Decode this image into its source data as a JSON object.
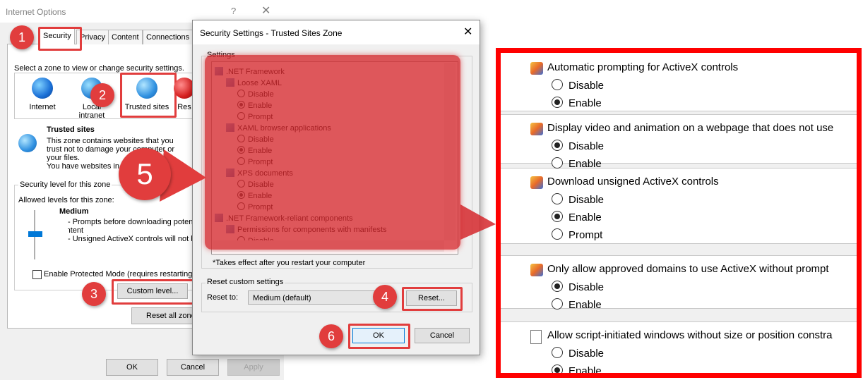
{
  "internet_options": {
    "title": "Internet Options",
    "help": "?",
    "close": "✕",
    "tabs": [
      "Security",
      "Privacy",
      "Content",
      "Connections"
    ],
    "zone_prompt": "Select a zone to view or change security settings.",
    "zones": [
      "Internet",
      "Local intranet",
      "Trusted sites",
      "Res"
    ],
    "zone_title": "Trusted sites",
    "zone_desc": [
      "This zone contains websites that you",
      "trust not to damage your computer or",
      "your files.",
      "You have websites in"
    ],
    "security_level_label": "Security level for this zone",
    "allowed_levels": "Allowed levels for this zone:",
    "level_name": "Medium",
    "level_points": [
      "- Prompts before downloading potenti",
      "content",
      "- Unsigned ActiveX controls will not be"
    ],
    "protected_mode": "Enable Protected Mode (requires restarting In",
    "custom_level": "Custom level...",
    "reset_all": "Reset all zones",
    "ok": "OK",
    "cancel": "Cancel",
    "apply": "Apply"
  },
  "security_settings": {
    "title": "Security Settings - Trusted Sites Zone",
    "close": "✕",
    "settings_label": "Settings",
    "tree": [
      {
        "type": "group",
        "text": ".NET Framework",
        "indent": 0
      },
      {
        "type": "group",
        "text": "Loose XAML",
        "indent": 1
      },
      {
        "type": "radio",
        "text": "Disable",
        "on": false,
        "indent": 2
      },
      {
        "type": "radio",
        "text": "Enable",
        "on": true,
        "indent": 2
      },
      {
        "type": "radio",
        "text": "Prompt",
        "on": false,
        "indent": 2
      },
      {
        "type": "group",
        "text": "XAML browser applications",
        "indent": 1
      },
      {
        "type": "radio",
        "text": "Disable",
        "on": false,
        "indent": 2
      },
      {
        "type": "radio",
        "text": "Enable",
        "on": true,
        "indent": 2
      },
      {
        "type": "radio",
        "text": "Prompt",
        "on": false,
        "indent": 2
      },
      {
        "type": "group",
        "text": "XPS documents",
        "indent": 1
      },
      {
        "type": "radio",
        "text": "Disable",
        "on": false,
        "indent": 2
      },
      {
        "type": "radio",
        "text": "Enable",
        "on": true,
        "indent": 2
      },
      {
        "type": "radio",
        "text": "Prompt",
        "on": false,
        "indent": 2
      },
      {
        "type": "group",
        "text": ".NET Framework-reliant components",
        "indent": 0
      },
      {
        "type": "group",
        "text": "Permissions for components with manifests",
        "indent": 1
      },
      {
        "type": "radio",
        "text": "Disable",
        "on": false,
        "indent": 2
      }
    ],
    "note": "*Takes effect after you restart your computer",
    "reset_custom_label": "Reset custom settings",
    "reset_to_label": "Reset to:",
    "reset_to_value": "Medium (default)",
    "reset_button": "Reset...",
    "ok": "OK",
    "cancel": "Cancel"
  },
  "callouts": [
    "1",
    "2",
    "3",
    "4",
    "5",
    "6"
  ],
  "zoomed_settings": [
    {
      "title": "Automatic prompting for ActiveX controls",
      "icon": "activex-shield-icon",
      "options": [
        {
          "label": "Disable",
          "on": false
        },
        {
          "label": "Enable",
          "on": true
        }
      ]
    },
    {
      "title": "Display video and animation on a webpage that does not use",
      "icon": "activex-shield-icon",
      "options": [
        {
          "label": "Disable",
          "on": true
        },
        {
          "label": "Enable",
          "on": false
        }
      ]
    },
    {
      "title": "Download unsigned ActiveX controls",
      "icon": "activex-shield-icon",
      "options": [
        {
          "label": "Disable",
          "on": false
        },
        {
          "label": "Enable",
          "on": true
        },
        {
          "label": "Prompt",
          "on": false
        }
      ]
    },
    {
      "title": "Only allow approved domains to use ActiveX without prompt",
      "icon": "activex-shield-icon",
      "options": [
        {
          "label": "Disable",
          "on": true
        },
        {
          "label": "Enable",
          "on": false
        }
      ]
    },
    {
      "title": "Allow script-initiated windows without size or position constra",
      "icon": "document-icon",
      "options": [
        {
          "label": "Disable",
          "on": false
        },
        {
          "label": "Enable",
          "on": true
        }
      ]
    }
  ],
  "colors": {
    "callout": "#e13d3d",
    "overlay": "#d5282d",
    "zoom_border": "#ff0000",
    "ok_border": "#0078d7"
  }
}
